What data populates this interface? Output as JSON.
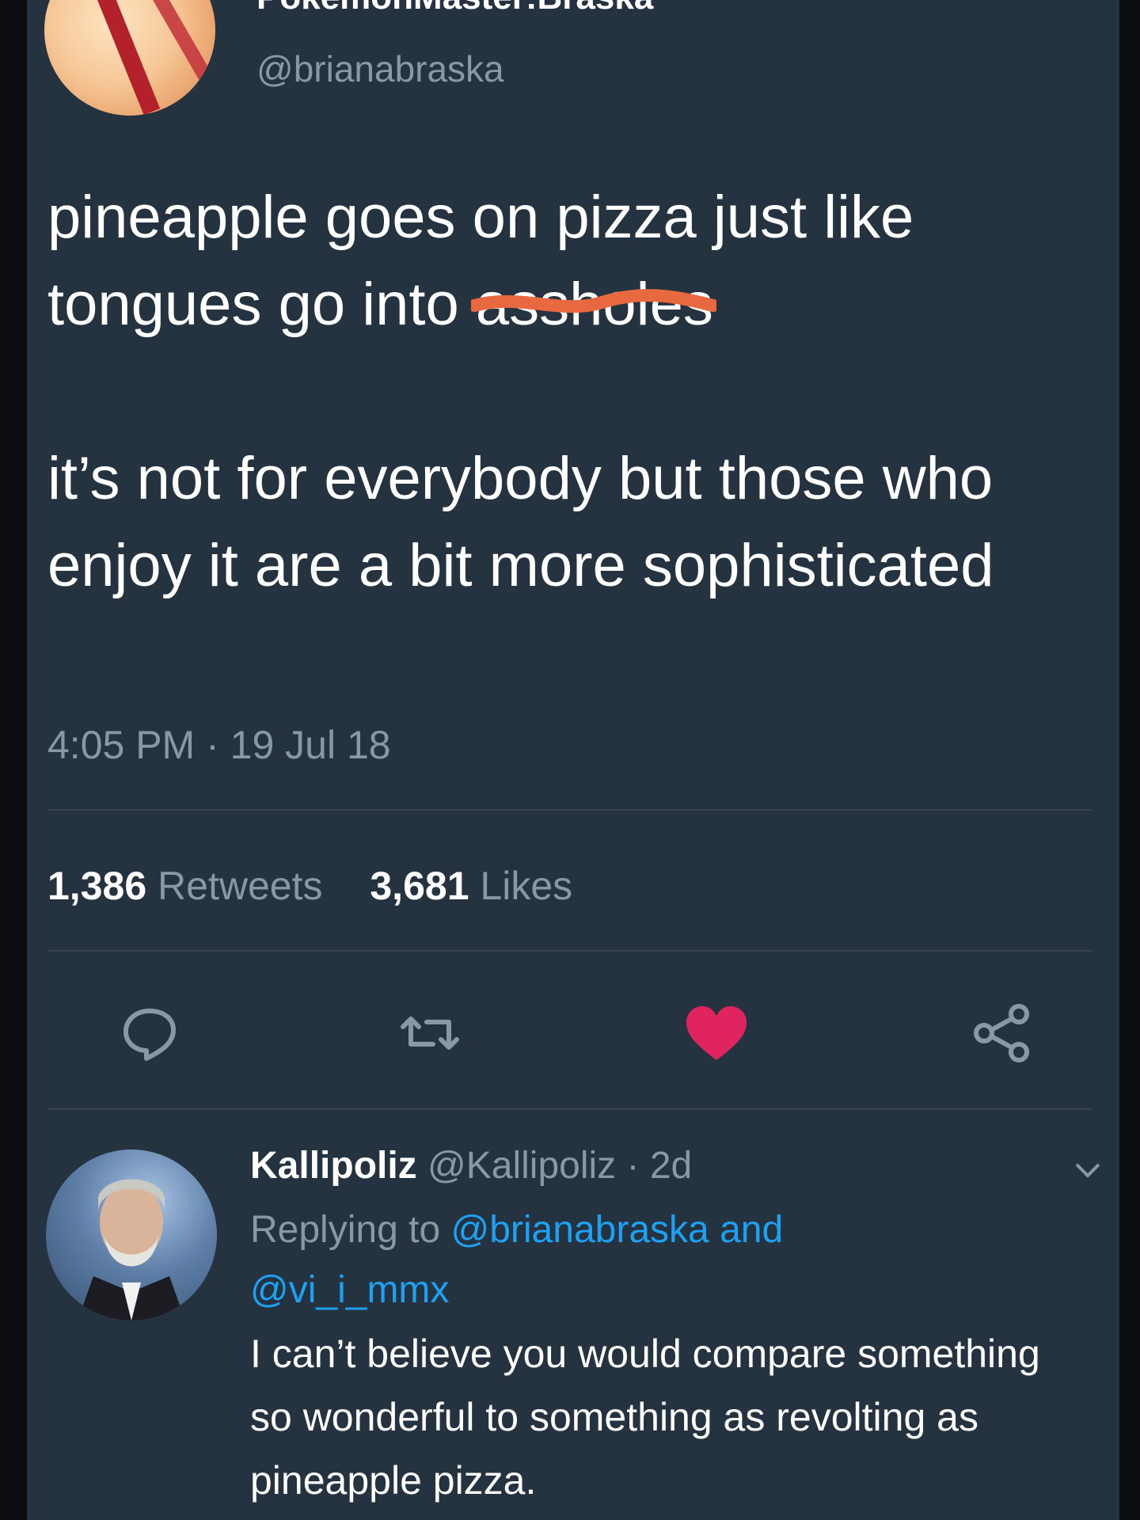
{
  "tweet": {
    "display_name": "PokemonMaster:Braska",
    "handle": "@brianabraska",
    "line1": "pineapple goes on pizza just like",
    "line2_prefix": "tongues go into ",
    "line2_censored": "assholes",
    "para2": "it’s not for everybody but those who enjoy it are a bit more sophisticated",
    "timestamp": "4:05 PM · 19 Jul 18",
    "retweets_count": "1,386",
    "retweets_label": "Retweets",
    "likes_count": "3,681",
    "likes_label": "Likes"
  },
  "actions": {
    "reply_icon": "reply-bubble-icon",
    "retweet_icon": "retweet-icon",
    "like_icon": "heart-icon",
    "share_icon": "share-icon",
    "like_color": "#e0245e"
  },
  "reply": {
    "name": "Kallipoliz",
    "handle": "@Kallipoliz",
    "age": "· 2d",
    "replying_prefix": "Replying to",
    "mention1": "@brianabraska",
    "and": "and",
    "mention2": "@vi_i_mmx",
    "text": "I can’t believe you would compare something so wonderful to something as revolting as pineapple pizza."
  },
  "colors": {
    "background": "#253341",
    "secondary_text": "#8899a6",
    "link": "#1da1f2",
    "scribble": "#e8683f"
  }
}
